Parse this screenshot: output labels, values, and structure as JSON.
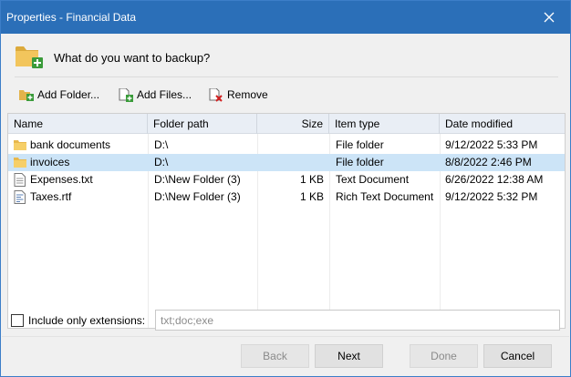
{
  "window": {
    "title": "Properties - Financial Data",
    "accent_color": "#2b6fb8"
  },
  "header": {
    "question": "What do you want to backup?",
    "icon": "folder-add-icon"
  },
  "toolbar": {
    "add_folder": "Add Folder...",
    "add_files": "Add Files...",
    "remove": "Remove"
  },
  "table": {
    "columns": [
      "Name",
      "Folder path",
      "Size",
      "Item type",
      "Date modified"
    ],
    "rows": [
      {
        "name": "bank documents",
        "path": "D:\\",
        "size": "",
        "type": "File folder",
        "date": "9/12/2022 5:33 PM",
        "icon": "folder-icon",
        "selected": false
      },
      {
        "name": "invoices",
        "path": "D:\\",
        "size": "",
        "type": "File folder",
        "date": "8/8/2022 2:46 PM",
        "icon": "folder-icon",
        "selected": true
      },
      {
        "name": "Expenses.txt",
        "path": "D:\\New Folder (3)",
        "size": "1 KB",
        "type": "Text Document",
        "date": "6/26/2022 12:38 AM",
        "icon": "text-file-icon",
        "selected": false
      },
      {
        "name": "Taxes.rtf",
        "path": "D:\\New Folder (3)",
        "size": "1 KB",
        "type": "Rich Text Document",
        "date": "9/12/2022 5:32 PM",
        "icon": "rtf-file-icon",
        "selected": false
      }
    ]
  },
  "extensions": {
    "label": "Include only extensions:",
    "placeholder": "txt;doc;exe",
    "value": "",
    "checked": false
  },
  "buttons": {
    "back": "Back",
    "next": "Next",
    "done": "Done",
    "cancel": "Cancel"
  }
}
